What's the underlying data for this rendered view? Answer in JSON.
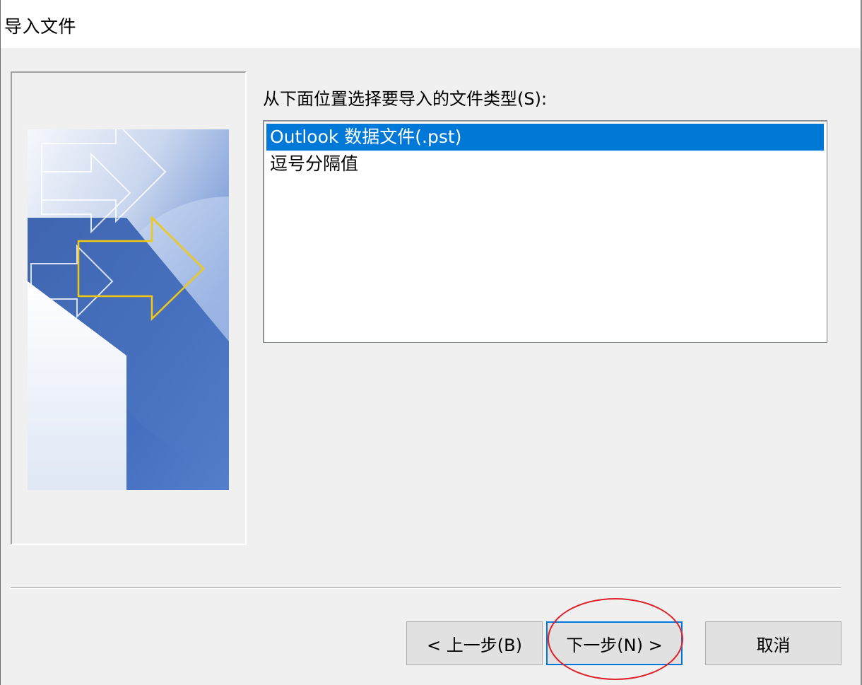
{
  "window": {
    "title": "导入文件"
  },
  "prompt": {
    "label": "从下面位置选择要导入的文件类型(S):"
  },
  "file_types": {
    "items": [
      {
        "label": "Outlook 数据文件(.pst)",
        "selected": true
      },
      {
        "label": "逗号分隔值",
        "selected": false
      }
    ]
  },
  "buttons": {
    "back_label": "< 上一步(B)",
    "next_label": "下一步(N) >",
    "cancel_label": "取消"
  },
  "colors": {
    "selection": "#0078d7",
    "annotation_circle": "#e0212a",
    "accent_arrow": "#f2c811"
  },
  "icons": {
    "wizard_art": "import-wizard-arrows-illustration"
  }
}
